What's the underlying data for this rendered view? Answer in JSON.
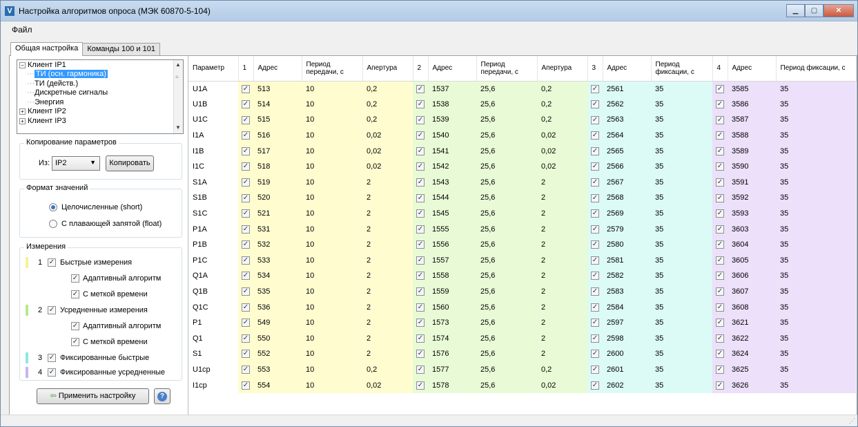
{
  "window": {
    "title": "Настройка алгоритмов опроса (МЭК 60870-5-104)"
  },
  "menu": {
    "file": "Файл"
  },
  "tabs": [
    "Общая настройка",
    "Команды 100 и 101"
  ],
  "tree": {
    "client1": "Клиент IP1",
    "item_selected": "ТИ (осн. гармоника)",
    "item2": "ТИ (действ.)",
    "item3": "Дискретные сигналы",
    "item4": "Энергия",
    "client2": "Клиент IP2",
    "client3": "Клиент IP3"
  },
  "copy": {
    "legend": "Копирование параметров",
    "from_label": "Из:",
    "from_value": "IP2",
    "button": "Копировать"
  },
  "format": {
    "legend": "Формат значений",
    "opt_short": "Целочисленные (short)",
    "opt_float": "С плавающей запятой (float)",
    "selected": "short"
  },
  "measure": {
    "legend": "Измерения",
    "colors": {
      "g1": "#f7f29a",
      "g2": "#b7e98c",
      "g3": "#8ee8e0",
      "g4": "#c9b3ef"
    },
    "g1_num": "1",
    "g1_label": "Быстрые измерения",
    "g1_adaptive": "Адаптивный алгоритм",
    "g1_timestamp": "С меткой времени",
    "g2_num": "2",
    "g2_label": "Усредненные измерения",
    "g2_adaptive": "Адаптивный алгоритм",
    "g2_timestamp": "С меткой времени",
    "g3_num": "3",
    "g3_label": "Фиксированные быстрые",
    "g4_num": "4",
    "g4_label": "Фиксированные усредненные"
  },
  "apply": {
    "button": "Применить настройку"
  },
  "grid": {
    "headers": {
      "param": "Параметр",
      "n1": "1",
      "addr1": "Адрес",
      "period1": "Период передачи, с",
      "aperture1": "Апертура",
      "n2": "2",
      "addr2": "Адрес",
      "period2": "Период передачи, с",
      "aperture2": "Апертура",
      "n3": "3",
      "addr3": "Адрес",
      "period3": "Период фиксации, с",
      "n4": "4",
      "addr4": "Адрес",
      "period4": "Период фиксации, с"
    },
    "rows": [
      [
        "U1A",
        "513",
        "10",
        "0,2",
        "1537",
        "25,6",
        "0,2",
        "2561",
        "35",
        "3585",
        "35"
      ],
      [
        "U1B",
        "514",
        "10",
        "0,2",
        "1538",
        "25,6",
        "0,2",
        "2562",
        "35",
        "3586",
        "35"
      ],
      [
        "U1C",
        "515",
        "10",
        "0,2",
        "1539",
        "25,6",
        "0,2",
        "2563",
        "35",
        "3587",
        "35"
      ],
      [
        "I1A",
        "516",
        "10",
        "0,02",
        "1540",
        "25,6",
        "0,02",
        "2564",
        "35",
        "3588",
        "35"
      ],
      [
        "I1B",
        "517",
        "10",
        "0,02",
        "1541",
        "25,6",
        "0,02",
        "2565",
        "35",
        "3589",
        "35"
      ],
      [
        "I1C",
        "518",
        "10",
        "0,02",
        "1542",
        "25,6",
        "0,02",
        "2566",
        "35",
        "3590",
        "35"
      ],
      [
        "S1A",
        "519",
        "10",
        "2",
        "1543",
        "25,6",
        "2",
        "2567",
        "35",
        "3591",
        "35"
      ],
      [
        "S1B",
        "520",
        "10",
        "2",
        "1544",
        "25,6",
        "2",
        "2568",
        "35",
        "3592",
        "35"
      ],
      [
        "S1C",
        "521",
        "10",
        "2",
        "1545",
        "25,6",
        "2",
        "2569",
        "35",
        "3593",
        "35"
      ],
      [
        "P1A",
        "531",
        "10",
        "2",
        "1555",
        "25,6",
        "2",
        "2579",
        "35",
        "3603",
        "35"
      ],
      [
        "P1B",
        "532",
        "10",
        "2",
        "1556",
        "25,6",
        "2",
        "2580",
        "35",
        "3604",
        "35"
      ],
      [
        "P1C",
        "533",
        "10",
        "2",
        "1557",
        "25,6",
        "2",
        "2581",
        "35",
        "3605",
        "35"
      ],
      [
        "Q1A",
        "534",
        "10",
        "2",
        "1558",
        "25,6",
        "2",
        "2582",
        "35",
        "3606",
        "35"
      ],
      [
        "Q1B",
        "535",
        "10",
        "2",
        "1559",
        "25,6",
        "2",
        "2583",
        "35",
        "3607",
        "35"
      ],
      [
        "Q1C",
        "536",
        "10",
        "2",
        "1560",
        "25,6",
        "2",
        "2584",
        "35",
        "3608",
        "35"
      ],
      [
        "P1",
        "549",
        "10",
        "2",
        "1573",
        "25,6",
        "2",
        "2597",
        "35",
        "3621",
        "35"
      ],
      [
        "Q1",
        "550",
        "10",
        "2",
        "1574",
        "25,6",
        "2",
        "2598",
        "35",
        "3622",
        "35"
      ],
      [
        "S1",
        "552",
        "10",
        "2",
        "1576",
        "25,6",
        "2",
        "2600",
        "35",
        "3624",
        "35"
      ],
      [
        "U1ср",
        "553",
        "10",
        "0,2",
        "1577",
        "25,6",
        "0,2",
        "2601",
        "35",
        "3625",
        "35"
      ],
      [
        "I1ср",
        "554",
        "10",
        "0,02",
        "1578",
        "25,6",
        "0,02",
        "2602",
        "35",
        "3626",
        "35"
      ]
    ]
  }
}
